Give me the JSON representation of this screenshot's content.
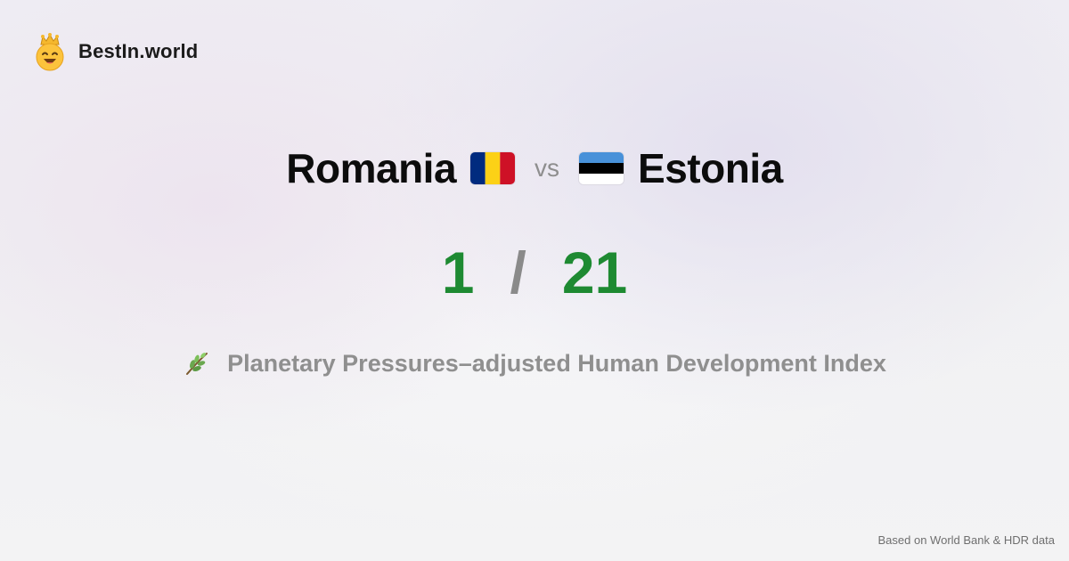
{
  "brand": {
    "name": "BestIn.world",
    "logo_icon": "crown-smiley-icon"
  },
  "comparison": {
    "left": {
      "name": "Romania",
      "flag_icon": "romania-flag-icon",
      "flag_colors": [
        "#002b7f",
        "#fcd116",
        "#ce1126"
      ],
      "rank": "1"
    },
    "vs_label": "vs",
    "right": {
      "name": "Estonia",
      "flag_icon": "estonia-flag-icon",
      "flag_colors": [
        "#4891d9",
        "#000000",
        "#ffffff"
      ],
      "rank": "21"
    },
    "separator": "/"
  },
  "metric": {
    "icon": "herb-icon",
    "label": "Planetary Pressures–adjusted Human Development Index"
  },
  "footer": {
    "source": "Based on World Bank & HDR data"
  },
  "colors": {
    "rank_green": "#1e8a32",
    "muted_gray": "#8f8f8f"
  }
}
